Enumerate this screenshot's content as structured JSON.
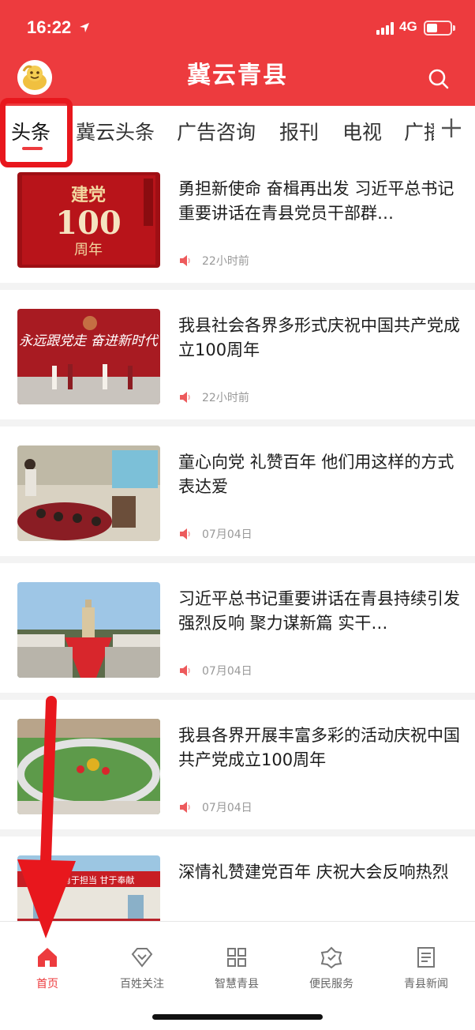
{
  "status_bar": {
    "time": "16:22",
    "network": "4G",
    "battery_percent": 35
  },
  "header": {
    "title": "冀云青县",
    "avatar_icon": "avatar-icon",
    "search_icon": "search-icon",
    "background": "#ed3b3e"
  },
  "tabs": {
    "items": [
      {
        "label": "头条"
      },
      {
        "label": "冀云头条"
      },
      {
        "label": "广告咨询"
      },
      {
        "label": "报刊"
      },
      {
        "label": "电视"
      },
      {
        "label": "广播"
      }
    ],
    "active_index": 0,
    "add_icon": "plus-icon"
  },
  "news": [
    {
      "title": "勇担新使命 奋楫再出发 习近平总书记重要讲话在青县党员干部群…",
      "time": "22小时前",
      "thumb_text": "建党100周年"
    },
    {
      "title": "我县社会各界多形式庆祝中国共产党成立100周年",
      "time": "22小时前",
      "thumb_text": "永远跟党走 奋进新时代"
    },
    {
      "title": "童心向党 礼赞百年 他们用这样的方式表达爱",
      "time": "07月04日"
    },
    {
      "title": "习近平总书记重要讲话在青县持续引发强烈反响 聚力谋新篇 实干…",
      "time": "07月04日"
    },
    {
      "title": "我县各界开展丰富多彩的活动庆祝中国共产党成立100周年",
      "time": "07月04日"
    },
    {
      "title": "深情礼赞建党百年 庆祝大会反响热烈",
      "time": "",
      "thumb_text": "使命 勇于担当 甘于奉献"
    }
  ],
  "bottom_nav": [
    {
      "label": "首页",
      "icon": "home-icon",
      "active": true
    },
    {
      "label": "百姓关注",
      "icon": "diamond-icon",
      "active": false
    },
    {
      "label": "智慧青县",
      "icon": "grid-icon",
      "active": false
    },
    {
      "label": "便民服务",
      "icon": "service-icon",
      "active": false
    },
    {
      "label": "青县新闻",
      "icon": "document-icon",
      "active": false
    }
  ],
  "colors": {
    "accent": "#ed3b3e",
    "annotation": "#e8171d"
  }
}
